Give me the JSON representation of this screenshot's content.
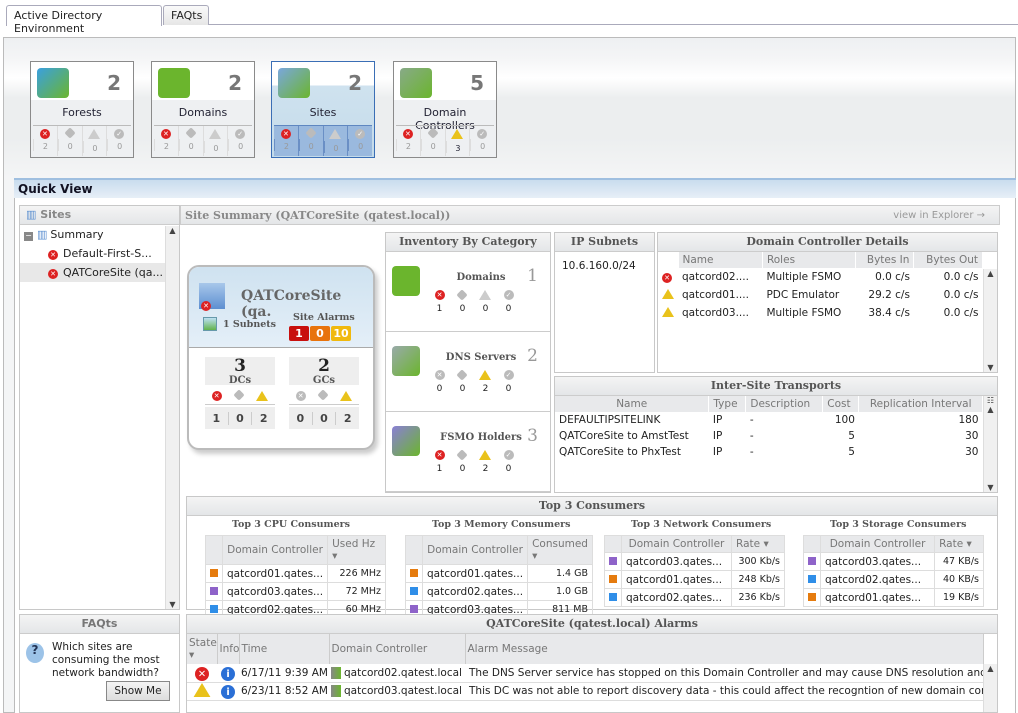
{
  "tabs": [
    {
      "label": "Active Directory Environment",
      "active": true
    },
    {
      "label": "FAQts",
      "active": false
    }
  ],
  "tiles": [
    {
      "label": "Forests",
      "count": "2",
      "status": [
        "2",
        "0",
        "0",
        "0"
      ],
      "selected": false
    },
    {
      "label": "Domains",
      "count": "2",
      "status": [
        "2",
        "0",
        "0",
        "0"
      ],
      "selected": false
    },
    {
      "label": "Sites",
      "count": "2",
      "status": [
        "2",
        "0",
        "0",
        "0"
      ],
      "selected": true
    },
    {
      "label": "Domain Controllers",
      "count": "5",
      "status": [
        "2",
        "0",
        "3",
        "0"
      ],
      "selected": false
    }
  ],
  "quick_view": {
    "title": "Quick View"
  },
  "sites_panel": {
    "title": "Sites",
    "tree": [
      {
        "label": "Summary"
      },
      {
        "label": "Default-First-S...",
        "state": "error"
      },
      {
        "label": "QATCoreSite (qa...",
        "state": "error",
        "selected": true
      }
    ]
  },
  "site_summary": {
    "title": "Site Summary (QATCoreSite (qatest.local))",
    "view_link": "view in Explorer"
  },
  "site_card": {
    "name": "QATCoreSite (qa.",
    "subnets": "1 Subnets",
    "alarms_label": "Site Alarms",
    "alarms": [
      "1",
      "0",
      "10"
    ],
    "dcs": {
      "value": "3",
      "label": "DCs",
      "counts": [
        "1",
        "0",
        "2"
      ]
    },
    "gcs": {
      "value": "2",
      "label": "GCs",
      "counts": [
        "0",
        "0",
        "2"
      ]
    }
  },
  "inventory": {
    "title": "Inventory By Category",
    "rows": [
      {
        "label": "Domains",
        "count": "1",
        "status": [
          "1",
          "0",
          "0",
          "0"
        ]
      },
      {
        "label": "DNS Servers",
        "count": "2",
        "status": [
          "0",
          "0",
          "2",
          "0"
        ]
      },
      {
        "label": "FSMO Holders",
        "count": "3",
        "status": [
          "1",
          "0",
          "2",
          "0"
        ]
      }
    ]
  },
  "ip_subnets": {
    "title": "IP Subnets",
    "items": [
      "10.6.160.0/24"
    ]
  },
  "dc_details": {
    "title": "Domain Controller Details",
    "columns": [
      "Name",
      "Roles",
      "Bytes In",
      "Bytes Out"
    ],
    "rows": [
      {
        "state": "error",
        "name": "qatcord02....",
        "roles": "Multiple FSMO",
        "in": "0.0 c/s",
        "out": "0.0 c/s"
      },
      {
        "state": "warning",
        "name": "qatcord01....",
        "roles": "PDC Emulator",
        "in": "29.2 c/s",
        "out": "0.0 c/s"
      },
      {
        "state": "warning",
        "name": "qatcord03....",
        "roles": "Multiple FSMO",
        "in": "38.4 c/s",
        "out": "0.0 c/s"
      }
    ]
  },
  "transports": {
    "title": "Inter-Site Transports",
    "columns": [
      "Name",
      "Type",
      "Description",
      "Cost",
      "Replication Interval"
    ],
    "rows": [
      [
        "DEFAULTIPSITELINK",
        "IP",
        "-",
        "100",
        "180"
      ],
      [
        "QATCoreSite to AmstTest",
        "IP",
        "-",
        "5",
        "30"
      ],
      [
        "QATCoreSite to PhxTest",
        "IP",
        "-",
        "5",
        "30"
      ]
    ]
  },
  "consumers": {
    "title": "Top 3 Consumers",
    "colors": {
      "orange": "#e57b0e",
      "purple": "#8e63c9",
      "blue": "#2f8ee8"
    },
    "groups": [
      {
        "title": "Top 3 CPU Consumers",
        "col1": "Domain Controller",
        "col2": "Used Hz",
        "rows": [
          {
            "color": "#e57b0e",
            "name": "qatcord01.qates...",
            "value": "226 MHz"
          },
          {
            "color": "#8e63c9",
            "name": "qatcord03.qates...",
            "value": "72 MHz"
          },
          {
            "color": "#2f8ee8",
            "name": "qatcord02.qates...",
            "value": "60 MHz"
          }
        ]
      },
      {
        "title": "Top 3 Memory Consumers",
        "col1": "Domain Controller",
        "col2": "Consumed",
        "rows": [
          {
            "color": "#e57b0e",
            "name": "qatcord01.qates...",
            "value": "1.4 GB"
          },
          {
            "color": "#2f8ee8",
            "name": "qatcord02.qates...",
            "value": "1.0 GB"
          },
          {
            "color": "#8e63c9",
            "name": "qatcord03.qates...",
            "value": "811 MB"
          }
        ]
      },
      {
        "title": "Top 3 Network Consumers",
        "col1": "Domain Controller",
        "col2": "Rate",
        "rows": [
          {
            "color": "#8e63c9",
            "name": "qatcord03.qates...",
            "value": "300 Kb/s"
          },
          {
            "color": "#e57b0e",
            "name": "qatcord01.qates...",
            "value": "248 Kb/s"
          },
          {
            "color": "#2f8ee8",
            "name": "qatcord02.qates...",
            "value": "236 Kb/s"
          }
        ]
      },
      {
        "title": "Top 3 Storage Consumers",
        "col1": "Domain Controller",
        "col2": "Rate",
        "rows": [
          {
            "color": "#8e63c9",
            "name": "qatcord03.qates...",
            "value": "47 KB/s"
          },
          {
            "color": "#2f8ee8",
            "name": "qatcord02.qates...",
            "value": "40 KB/s"
          },
          {
            "color": "#e57b0e",
            "name": "qatcord01.qates...",
            "value": "19 KB/s"
          }
        ]
      }
    ]
  },
  "faqts": {
    "title": "FAQts",
    "question": "Which sites are consuming the most network bandwidth?",
    "button": "Show Me"
  },
  "alarms": {
    "title": "QATCoreSite (qatest.local) Alarms",
    "columns": [
      "State",
      "Info",
      "Time",
      "Domain Controller",
      "Alarm Message"
    ],
    "rows": [
      {
        "state": "error",
        "time": "6/17/11 9:39 AM",
        "dc": "qatcord02.qatest.local",
        "message": "The DNS Server service has stopped on this Domain Controller and may cause DNS resolution and replicatio"
      },
      {
        "state": "warning",
        "time": "6/23/11 8:52 AM",
        "dc": "qatcord03.qatest.local",
        "message": "This DC was not able to report discovery data - this could affect the recogntion of new domain controllers"
      }
    ]
  }
}
